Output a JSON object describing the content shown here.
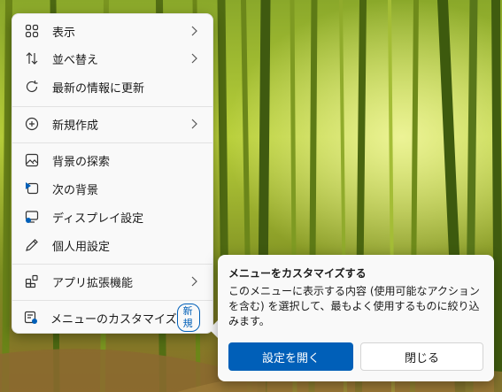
{
  "menu": {
    "items": [
      {
        "label": "表示",
        "icon": "grid-icon",
        "submenu": true
      },
      {
        "label": "並べ替え",
        "icon": "sort-icon",
        "submenu": true
      },
      {
        "label": "最新の情報に更新",
        "icon": "refresh-icon",
        "submenu": false
      },
      {
        "label": "新規作成",
        "icon": "plus-circle-icon",
        "submenu": true
      },
      {
        "label": "背景の探索",
        "icon": "image-icon",
        "submenu": false
      },
      {
        "label": "次の背景",
        "icon": "next-background-icon",
        "submenu": false
      },
      {
        "label": "ディスプレイ設定",
        "icon": "display-settings-icon",
        "submenu": false
      },
      {
        "label": "個人用設定",
        "icon": "pen-icon",
        "submenu": false
      },
      {
        "label": "アプリ拡張機能",
        "icon": "app-extensions-icon",
        "submenu": true
      },
      {
        "label": "メニューのカスタマイズ",
        "icon": "customize-menu-icon",
        "submenu": false,
        "badge": "新規"
      }
    ]
  },
  "tip": {
    "title": "メニューをカスタマイズする",
    "body": "このメニューに表示する内容 (使用可能なアクションを含む) を選択して、最もよく使用するものに絞り込みます。",
    "primary_button": "設定を開く",
    "secondary_button": "閉じる"
  },
  "colors": {
    "accent": "#005fb8",
    "menu_background": "#f9f9f9",
    "wallpaper": "#6f8a1e"
  }
}
